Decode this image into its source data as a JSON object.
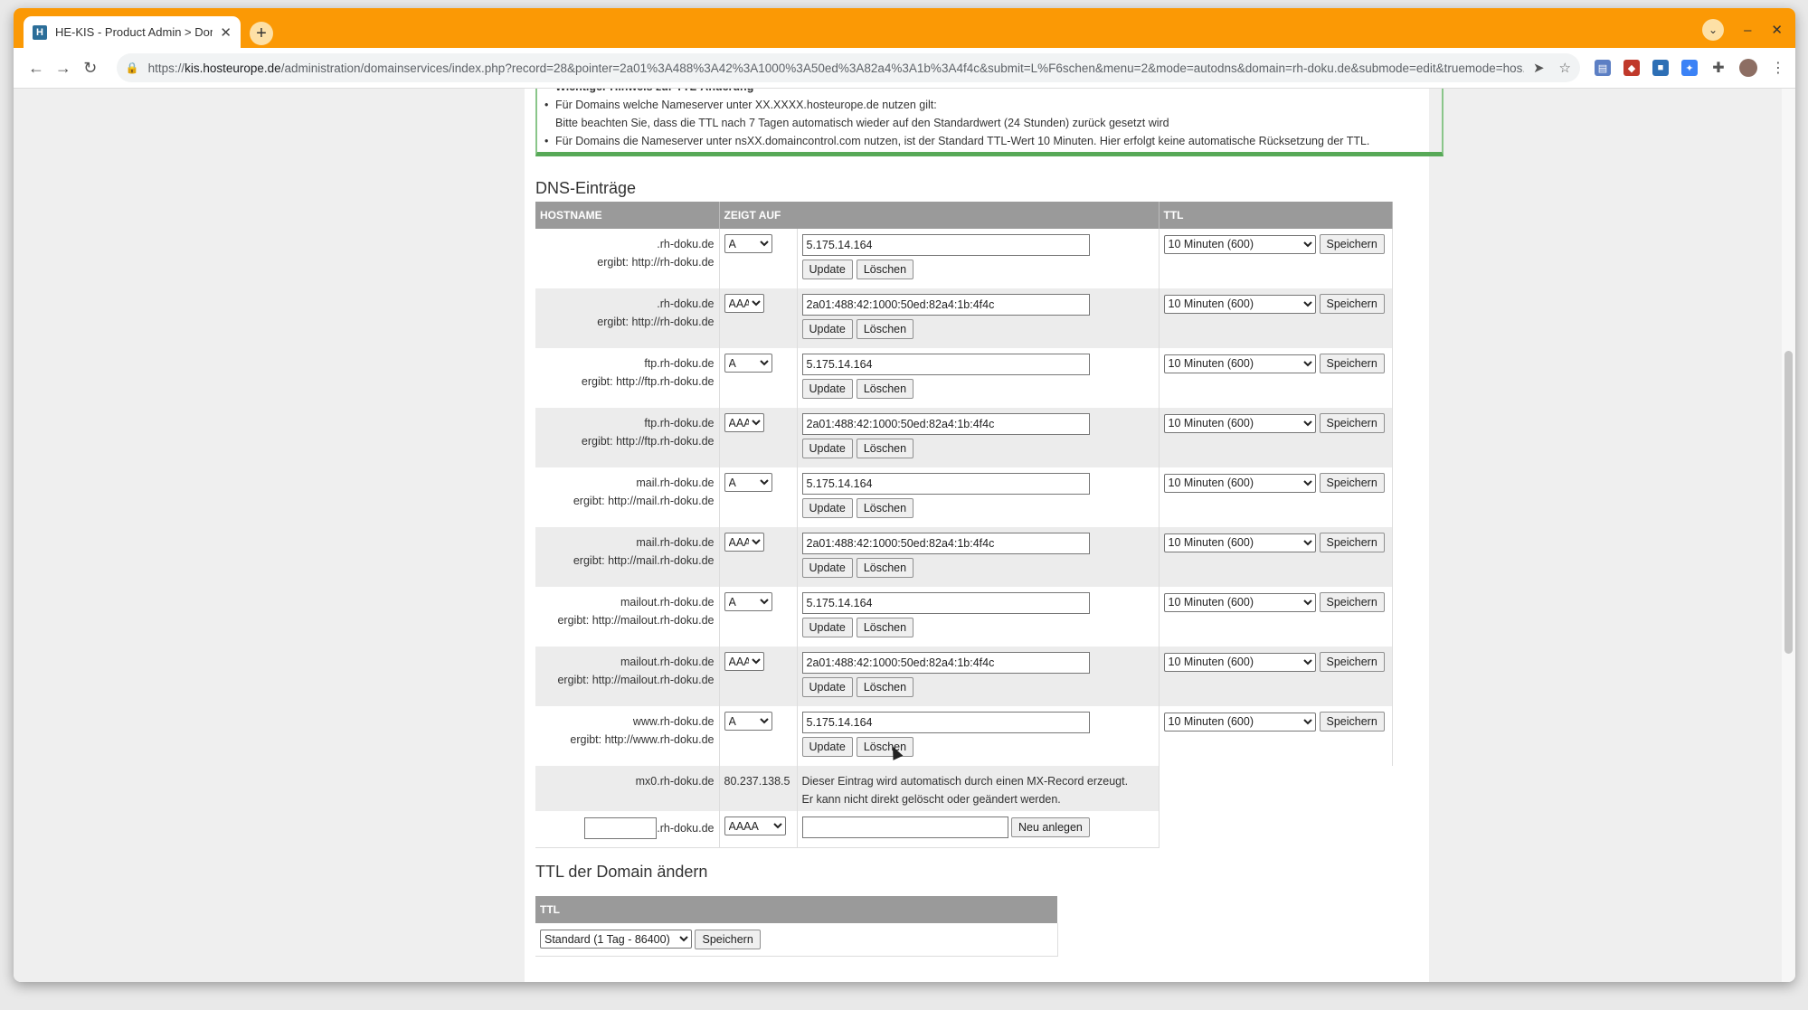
{
  "browser": {
    "tab_title": "HE-KIS - Product Admin > Dor",
    "tab_favicon": "H",
    "url_host": "kis.hosteurope.de",
    "url_scheme": "https://",
    "url_path": "/administration/domainservices/index.php?record=28&pointer=2a01%3A488%3A42%3A1000%3A50ed%3A82a4%3A1b%3A4f4c&submit=L%F6schen&menu=2&mode=autodns&domain=rh-doku.de&submode=edit&truemode=hos...",
    "accent": "#fb9905"
  },
  "notice": {
    "cut_line": "Wichtiger Hinweis zur TTL-Änderung",
    "line1": "Für Domains welche Nameserver unter XX.XXXX.hosteurope.de nutzen gilt:",
    "line2": "Bitte beachten Sie, dass die TTL nach 7 Tagen automatisch wieder auf den Standardwert (24 Stunden) zurück gesetzt wird",
    "line3": "Für Domains die Nameserver unter nsXX.domaincontrol.com nutzen, ist der Standard TTL-Wert 10 Minuten. Hier erfolgt keine automatische Rücksetzung der TTL."
  },
  "dns": {
    "heading": "DNS-Einträge",
    "col_hostname": "HOSTNAME",
    "col_points": "ZEIGT AUF",
    "col_ttl": "TTL",
    "update_label": "Update",
    "delete_label": "Löschen",
    "save_label": "Speichern",
    "records": [
      {
        "host": ".rh-doku.de",
        "result": "ergibt: http://rh-doku.de",
        "type": "A",
        "value": "5.175.14.164",
        "ttl": "10 Minuten (600)"
      },
      {
        "host": ".rh-doku.de",
        "result": "ergibt: http://rh-doku.de",
        "type": "AAAA",
        "value": "2a01:488:42:1000:50ed:82a4:1b:4f4c",
        "ttl": "10 Minuten (600)"
      },
      {
        "host": "ftp.rh-doku.de",
        "result": "ergibt: http://ftp.rh-doku.de",
        "type": "A",
        "value": "5.175.14.164",
        "ttl": "10 Minuten (600)"
      },
      {
        "host": "ftp.rh-doku.de",
        "result": "ergibt: http://ftp.rh-doku.de",
        "type": "AAAA",
        "value": "2a01:488:42:1000:50ed:82a4:1b:4f4c",
        "ttl": "10 Minuten (600)"
      },
      {
        "host": "mail.rh-doku.de",
        "result": "ergibt: http://mail.rh-doku.de",
        "type": "A",
        "value": "5.175.14.164",
        "ttl": "10 Minuten (600)"
      },
      {
        "host": "mail.rh-doku.de",
        "result": "ergibt: http://mail.rh-doku.de",
        "type": "AAAA",
        "value": "2a01:488:42:1000:50ed:82a4:1b:4f4c",
        "ttl": "10 Minuten (600)"
      },
      {
        "host": "mailout.rh-doku.de",
        "result": "ergibt: http://mailout.rh-doku.de",
        "type": "A",
        "value": "5.175.14.164",
        "ttl": "10 Minuten (600)"
      },
      {
        "host": "mailout.rh-doku.de",
        "result": "ergibt: http://mailout.rh-doku.de",
        "type": "AAAA",
        "value": "2a01:488:42:1000:50ed:82a4:1b:4f4c",
        "ttl": "10 Minuten (600)"
      },
      {
        "host": "www.rh-doku.de",
        "result": "ergibt: http://www.rh-doku.de",
        "type": "A",
        "value": "5.175.14.164",
        "ttl": "10 Minuten (600)"
      }
    ],
    "mx": {
      "host": "mx0.rh-doku.de",
      "value": "80.237.138.5",
      "note1": "Dieser Eintrag wird automatisch durch einen MX-Record erzeugt.",
      "note2": "Er kann nicht direkt gelöscht oder geändert werden."
    },
    "new_entry": {
      "suffix": ".rh-doku.de",
      "type": "AAAA",
      "host_value": "",
      "target_value": "",
      "create_label": "Neu anlegen"
    }
  },
  "domain_ttl": {
    "heading": "TTL der Domain ändern",
    "col_ttl": "TTL",
    "selected": "Standard (1 Tag - 86400)",
    "save_label": "Speichern"
  }
}
